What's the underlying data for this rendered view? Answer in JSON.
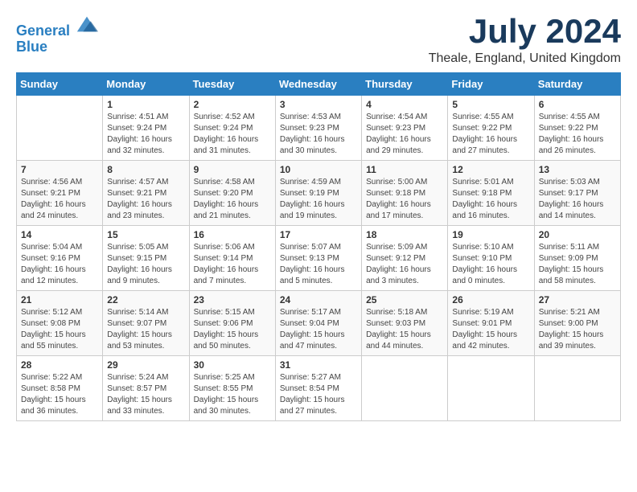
{
  "header": {
    "logo_line1": "General",
    "logo_line2": "Blue",
    "month_title": "July 2024",
    "location": "Theale, England, United Kingdom"
  },
  "days_of_week": [
    "Sunday",
    "Monday",
    "Tuesday",
    "Wednesday",
    "Thursday",
    "Friday",
    "Saturday"
  ],
  "weeks": [
    [
      {
        "day": "",
        "content": ""
      },
      {
        "day": "1",
        "content": "Sunrise: 4:51 AM\nSunset: 9:24 PM\nDaylight: 16 hours\nand 32 minutes."
      },
      {
        "day": "2",
        "content": "Sunrise: 4:52 AM\nSunset: 9:24 PM\nDaylight: 16 hours\nand 31 minutes."
      },
      {
        "day": "3",
        "content": "Sunrise: 4:53 AM\nSunset: 9:23 PM\nDaylight: 16 hours\nand 30 minutes."
      },
      {
        "day": "4",
        "content": "Sunrise: 4:54 AM\nSunset: 9:23 PM\nDaylight: 16 hours\nand 29 minutes."
      },
      {
        "day": "5",
        "content": "Sunrise: 4:55 AM\nSunset: 9:22 PM\nDaylight: 16 hours\nand 27 minutes."
      },
      {
        "day": "6",
        "content": "Sunrise: 4:55 AM\nSunset: 9:22 PM\nDaylight: 16 hours\nand 26 minutes."
      }
    ],
    [
      {
        "day": "7",
        "content": "Sunrise: 4:56 AM\nSunset: 9:21 PM\nDaylight: 16 hours\nand 24 minutes."
      },
      {
        "day": "8",
        "content": "Sunrise: 4:57 AM\nSunset: 9:21 PM\nDaylight: 16 hours\nand 23 minutes."
      },
      {
        "day": "9",
        "content": "Sunrise: 4:58 AM\nSunset: 9:20 PM\nDaylight: 16 hours\nand 21 minutes."
      },
      {
        "day": "10",
        "content": "Sunrise: 4:59 AM\nSunset: 9:19 PM\nDaylight: 16 hours\nand 19 minutes."
      },
      {
        "day": "11",
        "content": "Sunrise: 5:00 AM\nSunset: 9:18 PM\nDaylight: 16 hours\nand 17 minutes."
      },
      {
        "day": "12",
        "content": "Sunrise: 5:01 AM\nSunset: 9:18 PM\nDaylight: 16 hours\nand 16 minutes."
      },
      {
        "day": "13",
        "content": "Sunrise: 5:03 AM\nSunset: 9:17 PM\nDaylight: 16 hours\nand 14 minutes."
      }
    ],
    [
      {
        "day": "14",
        "content": "Sunrise: 5:04 AM\nSunset: 9:16 PM\nDaylight: 16 hours\nand 12 minutes."
      },
      {
        "day": "15",
        "content": "Sunrise: 5:05 AM\nSunset: 9:15 PM\nDaylight: 16 hours\nand 9 minutes."
      },
      {
        "day": "16",
        "content": "Sunrise: 5:06 AM\nSunset: 9:14 PM\nDaylight: 16 hours\nand 7 minutes."
      },
      {
        "day": "17",
        "content": "Sunrise: 5:07 AM\nSunset: 9:13 PM\nDaylight: 16 hours\nand 5 minutes."
      },
      {
        "day": "18",
        "content": "Sunrise: 5:09 AM\nSunset: 9:12 PM\nDaylight: 16 hours\nand 3 minutes."
      },
      {
        "day": "19",
        "content": "Sunrise: 5:10 AM\nSunset: 9:10 PM\nDaylight: 16 hours\nand 0 minutes."
      },
      {
        "day": "20",
        "content": "Sunrise: 5:11 AM\nSunset: 9:09 PM\nDaylight: 15 hours\nand 58 minutes."
      }
    ],
    [
      {
        "day": "21",
        "content": "Sunrise: 5:12 AM\nSunset: 9:08 PM\nDaylight: 15 hours\nand 55 minutes."
      },
      {
        "day": "22",
        "content": "Sunrise: 5:14 AM\nSunset: 9:07 PM\nDaylight: 15 hours\nand 53 minutes."
      },
      {
        "day": "23",
        "content": "Sunrise: 5:15 AM\nSunset: 9:06 PM\nDaylight: 15 hours\nand 50 minutes."
      },
      {
        "day": "24",
        "content": "Sunrise: 5:17 AM\nSunset: 9:04 PM\nDaylight: 15 hours\nand 47 minutes."
      },
      {
        "day": "25",
        "content": "Sunrise: 5:18 AM\nSunset: 9:03 PM\nDaylight: 15 hours\nand 44 minutes."
      },
      {
        "day": "26",
        "content": "Sunrise: 5:19 AM\nSunset: 9:01 PM\nDaylight: 15 hours\nand 42 minutes."
      },
      {
        "day": "27",
        "content": "Sunrise: 5:21 AM\nSunset: 9:00 PM\nDaylight: 15 hours\nand 39 minutes."
      }
    ],
    [
      {
        "day": "28",
        "content": "Sunrise: 5:22 AM\nSunset: 8:58 PM\nDaylight: 15 hours\nand 36 minutes."
      },
      {
        "day": "29",
        "content": "Sunrise: 5:24 AM\nSunset: 8:57 PM\nDaylight: 15 hours\nand 33 minutes."
      },
      {
        "day": "30",
        "content": "Sunrise: 5:25 AM\nSunset: 8:55 PM\nDaylight: 15 hours\nand 30 minutes."
      },
      {
        "day": "31",
        "content": "Sunrise: 5:27 AM\nSunset: 8:54 PM\nDaylight: 15 hours\nand 27 minutes."
      },
      {
        "day": "",
        "content": ""
      },
      {
        "day": "",
        "content": ""
      },
      {
        "day": "",
        "content": ""
      }
    ]
  ]
}
